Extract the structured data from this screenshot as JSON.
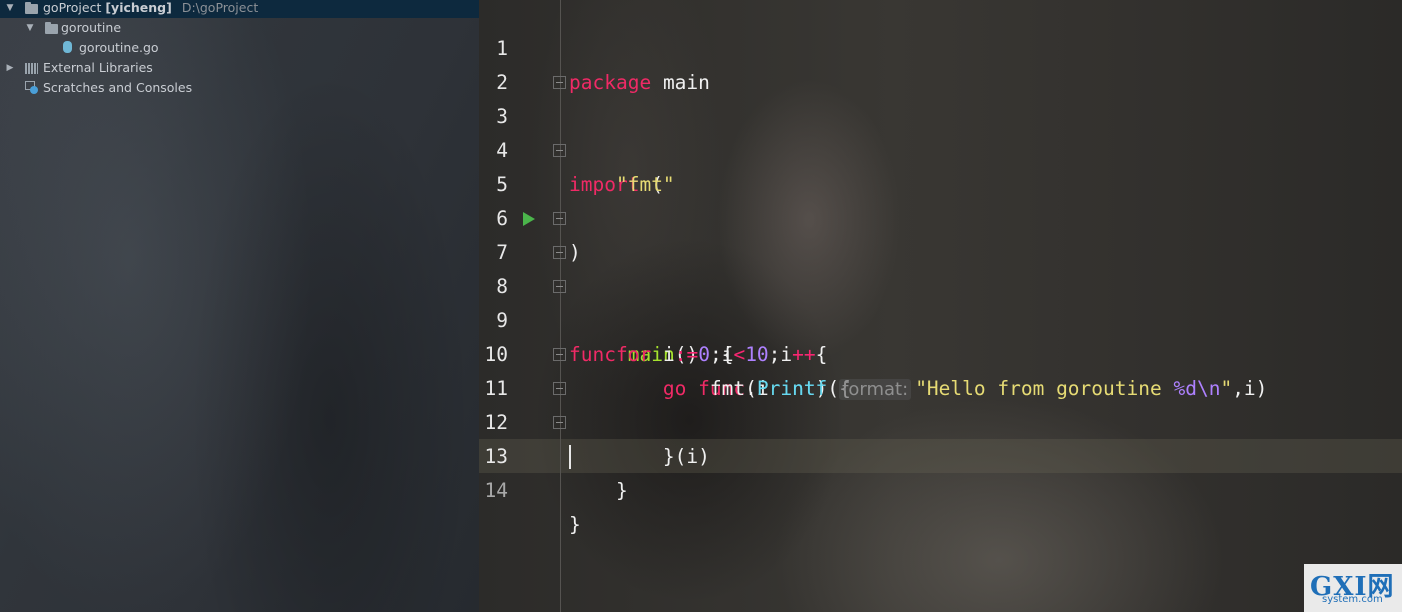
{
  "project_tree": {
    "root": {
      "name": "goProject",
      "module": "[yicheng]",
      "path": "D:\\goProject"
    },
    "folder": {
      "name": "goroutine"
    },
    "file": {
      "name": "goroutine.go"
    },
    "external_libraries": "External Libraries",
    "scratches": "Scratches and Consoles"
  },
  "editor": {
    "line_numbers": [
      "1",
      "2",
      "3",
      "4",
      "5",
      "6",
      "7",
      "8",
      "9",
      "10",
      "11",
      "12",
      "13",
      "14"
    ],
    "tokens": {
      "package": "package",
      "main": "main",
      "import": "import",
      "open_paren": "(",
      "fmt_str": "\"fmt\"",
      "close_paren": ")",
      "func": "func",
      "main_fn": "main",
      "parens_brace": "()  {",
      "for": "for",
      "i": "i",
      "assign": ":=",
      "zero": "0",
      "semi": ";",
      "lt": "<",
      "ten": "10",
      "incr": "++",
      "brace_open": "{",
      "go": "go",
      "func2": "func",
      "paren_i": "(i ",
      "int": "int",
      "paren_close_brace": ") {",
      "fmt": "fmt.",
      "printf": "Printf",
      "open": "(",
      "hint": "format:",
      "hello": "\"Hello from goroutine ",
      "fmt_verb": "%d\\n",
      "quote": "\"",
      "args": ",i)",
      "close_call": "}(i)",
      "close_for": "}",
      "close_main": "}"
    }
  },
  "watermark": {
    "logo": "GXI网",
    "site": "system.com"
  }
}
